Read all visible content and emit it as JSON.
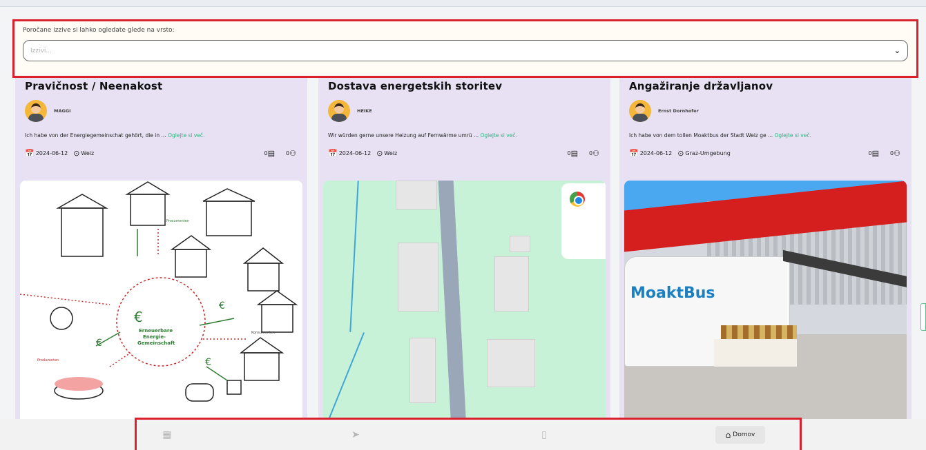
{
  "filter": {
    "label": "Poročane izzive si lahko ogledate glede na vrsto:",
    "placeholder": "Izzivi..."
  },
  "cards": [
    {
      "title": "Pravičnost / Neenakost",
      "author": "MAGGI",
      "excerpt": "Ich habe von der Energiegemeinschat gehört, die in ...",
      "more": "Oglejte si več.",
      "date": "2024-06-12",
      "location": "Weiz",
      "comments": "0",
      "supporters": "0",
      "illustration_labels": {
        "prosumers": "Prosumenten",
        "consumers": "Konsumenten",
        "producers": "Produzenten",
        "center": [
          "Erneuerbare",
          "Energie-",
          "Gemeinschaft"
        ]
      }
    },
    {
      "title": "Dostava energetskih storitev",
      "author": "HEIKE",
      "excerpt": "Wir würden gerne unsere Heizung auf Fernwärme umrü ...",
      "more": "Oglejte si več.",
      "date": "2024-06-12",
      "location": "Weiz",
      "comments": "0",
      "supporters": "0"
    },
    {
      "title": "Angažiranje državljanov",
      "author": "Ernst Dornhofer",
      "excerpt": "Ich habe von dem tollen Moaktbus der Stadt Weiz ge ...",
      "more": "Oglejte si več.",
      "date": "2024-06-12",
      "location": "Graz-Umgebung",
      "comments": "0",
      "supporters": "0",
      "photo_text": "MoaktBus"
    }
  ],
  "nav": {
    "items": [
      "dashboard-icon",
      "send-icon",
      "map-icon",
      "home-icon"
    ],
    "home_label": "Domov"
  },
  "colors": {
    "card_bg": "#e7e1f3",
    "accent_link": "#2fb27d",
    "highlight": "#d9202c"
  }
}
